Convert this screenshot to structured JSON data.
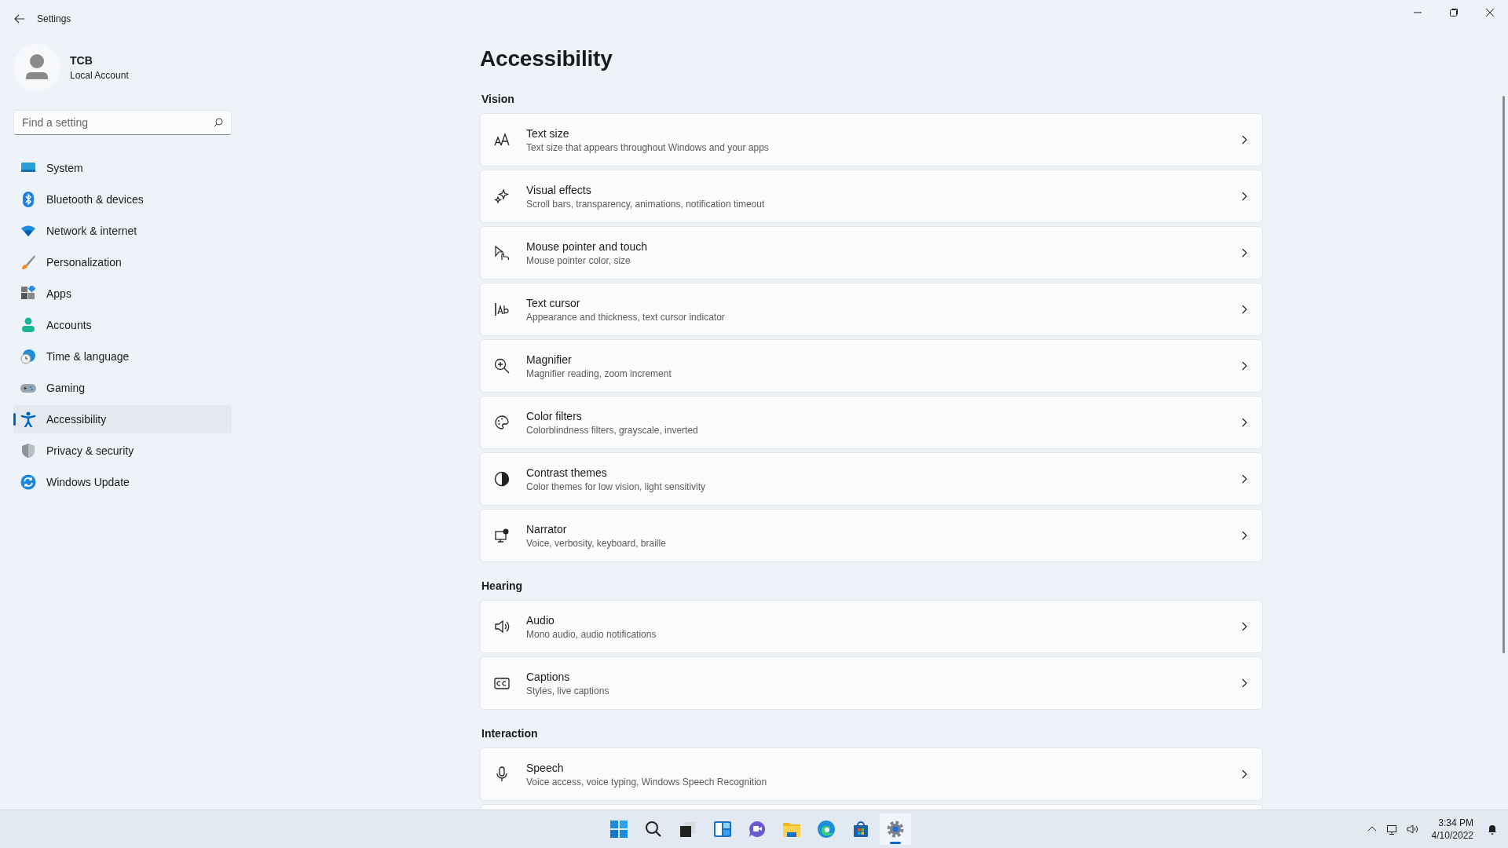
{
  "window": {
    "title": "Settings"
  },
  "profile": {
    "name": "TCB",
    "account_type": "Local Account"
  },
  "search": {
    "placeholder": "Find a setting"
  },
  "nav": [
    {
      "label": "System",
      "selected": false
    },
    {
      "label": "Bluetooth & devices",
      "selected": false
    },
    {
      "label": "Network & internet",
      "selected": false
    },
    {
      "label": "Personalization",
      "selected": false
    },
    {
      "label": "Apps",
      "selected": false
    },
    {
      "label": "Accounts",
      "selected": false
    },
    {
      "label": "Time & language",
      "selected": false
    },
    {
      "label": "Gaming",
      "selected": false
    },
    {
      "label": "Accessibility",
      "selected": true
    },
    {
      "label": "Privacy & security",
      "selected": false
    },
    {
      "label": "Windows Update",
      "selected": false
    }
  ],
  "page_title": "Accessibility",
  "sections": [
    {
      "heading": "Vision",
      "items": [
        {
          "title": "Text size",
          "subtitle": "Text size that appears throughout Windows and your apps"
        },
        {
          "title": "Visual effects",
          "subtitle": "Scroll bars, transparency, animations, notification timeout"
        },
        {
          "title": "Mouse pointer and touch",
          "subtitle": "Mouse pointer color, size"
        },
        {
          "title": "Text cursor",
          "subtitle": "Appearance and thickness, text cursor indicator"
        },
        {
          "title": "Magnifier",
          "subtitle": "Magnifier reading, zoom increment"
        },
        {
          "title": "Color filters",
          "subtitle": "Colorblindness filters, grayscale, inverted"
        },
        {
          "title": "Contrast themes",
          "subtitle": "Color themes for low vision, light sensitivity"
        },
        {
          "title": "Narrator",
          "subtitle": "Voice, verbosity, keyboard, braille"
        }
      ]
    },
    {
      "heading": "Hearing",
      "items": [
        {
          "title": "Audio",
          "subtitle": "Mono audio, audio notifications"
        },
        {
          "title": "Captions",
          "subtitle": "Styles, live captions"
        }
      ]
    },
    {
      "heading": "Interaction",
      "items": [
        {
          "title": "Speech",
          "subtitle": "Voice access, voice typing, Windows Speech Recognition"
        }
      ]
    }
  ],
  "taskbar": {
    "apps": [
      {
        "selected": false
      },
      {
        "selected": false
      },
      {
        "selected": false
      },
      {
        "selected": false
      },
      {
        "selected": false
      },
      {
        "selected": false
      },
      {
        "selected": false
      },
      {
        "selected": false
      },
      {
        "selected": true
      }
    ],
    "time": "3:34 PM",
    "date": "4/10/2022"
  }
}
